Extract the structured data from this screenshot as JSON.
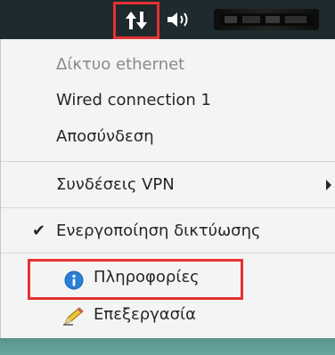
{
  "tray": {
    "network_icon": "network-up-down-icon",
    "volume_icon": "volume-icon",
    "clock_text": "ᴣᴣᴣᴣᴣᴣᴣᴣ"
  },
  "menu": {
    "network_header": "Δίκτυο ethernet",
    "connection_name": "Wired connection 1",
    "disconnect": "Αποσύνδεση",
    "vpn": "Συνδέσεις VPN",
    "enable_networking": "Ενεργοποίηση δικτύωσης",
    "enable_networking_checked": true,
    "info": "Πληροφορίες",
    "edit": "Επεξεργασία"
  },
  "colors": {
    "highlight": "#e53232",
    "menu_bg": "#f4f4f4",
    "panel_bg": "#1e2a2d"
  }
}
